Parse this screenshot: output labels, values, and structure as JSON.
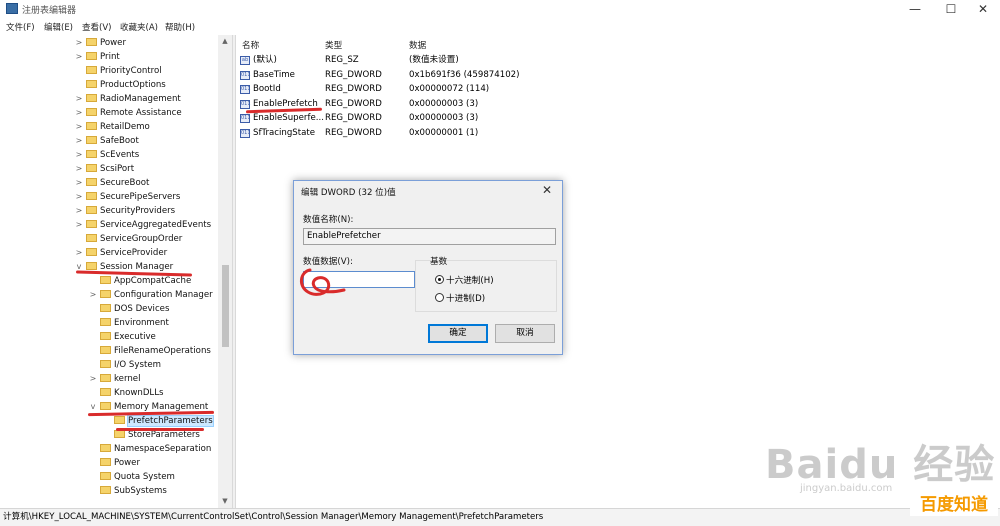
{
  "window": {
    "title": "注册表编辑器",
    "controls": {
      "minimize": "—",
      "maximize": "☐",
      "close": "✕"
    }
  },
  "menu": [
    "文件(F)",
    "编辑(E)",
    "查看(V)",
    "收藏夹(A)",
    "帮助(H)"
  ],
  "tree": [
    {
      "label": "Power",
      "expander": ">",
      "level": 0
    },
    {
      "label": "Print",
      "expander": ">",
      "level": 0
    },
    {
      "label": "PriorityControl",
      "expander": "",
      "level": 0
    },
    {
      "label": "ProductOptions",
      "expander": "",
      "level": 0
    },
    {
      "label": "RadioManagement",
      "expander": ">",
      "level": 0
    },
    {
      "label": "Remote Assistance",
      "expander": ">",
      "level": 0
    },
    {
      "label": "RetailDemo",
      "expander": ">",
      "level": 0
    },
    {
      "label": "SafeBoot",
      "expander": ">",
      "level": 0
    },
    {
      "label": "ScEvents",
      "expander": ">",
      "level": 0
    },
    {
      "label": "ScsiPort",
      "expander": ">",
      "level": 0
    },
    {
      "label": "SecureBoot",
      "expander": ">",
      "level": 0
    },
    {
      "label": "SecurePipeServers",
      "expander": ">",
      "level": 0
    },
    {
      "label": "SecurityProviders",
      "expander": ">",
      "level": 0
    },
    {
      "label": "ServiceAggregatedEvents",
      "expander": ">",
      "level": 0
    },
    {
      "label": "ServiceGroupOrder",
      "expander": "",
      "level": 0
    },
    {
      "label": "ServiceProvider",
      "expander": ">",
      "level": 0
    },
    {
      "label": "Session Manager",
      "expander": "v",
      "level": 0
    },
    {
      "label": "AppCompatCache",
      "expander": "",
      "level": 1
    },
    {
      "label": "Configuration Manager",
      "expander": ">",
      "level": 1
    },
    {
      "label": "DOS Devices",
      "expander": "",
      "level": 1
    },
    {
      "label": "Environment",
      "expander": "",
      "level": 1
    },
    {
      "label": "Executive",
      "expander": "",
      "level": 1
    },
    {
      "label": "FileRenameOperations",
      "expander": "",
      "level": 1
    },
    {
      "label": "I/O System",
      "expander": "",
      "level": 1
    },
    {
      "label": "kernel",
      "expander": ">",
      "level": 1
    },
    {
      "label": "KnownDLLs",
      "expander": "",
      "level": 1
    },
    {
      "label": "Memory Management",
      "expander": "v",
      "level": 1
    },
    {
      "label": "PrefetchParameters",
      "expander": "",
      "level": 2,
      "selected": true
    },
    {
      "label": "StoreParameters",
      "expander": "",
      "level": 2
    },
    {
      "label": "NamespaceSeparation",
      "expander": "",
      "level": 1
    },
    {
      "label": "Power",
      "expander": "",
      "level": 1
    },
    {
      "label": "Quota System",
      "expander": "",
      "level": 1
    },
    {
      "label": "SubSystems",
      "expander": "",
      "level": 1
    }
  ],
  "columns": {
    "name": "名称",
    "type": "类型",
    "data": "数据"
  },
  "values": [
    {
      "name": "(默认)",
      "type": "REG_SZ",
      "data": "(数值未设置)",
      "icon": "ab"
    },
    {
      "name": "BaseTime",
      "type": "REG_DWORD",
      "data": "0x1b691f36 (459874102)",
      "icon": "011"
    },
    {
      "name": "BootId",
      "type": "REG_DWORD",
      "data": "0x00000072 (114)",
      "icon": "011"
    },
    {
      "name": "EnablePrefetch",
      "type": "REG_DWORD",
      "data": "0x00000003 (3)",
      "icon": "011"
    },
    {
      "name": "EnableSuperfe...",
      "type": "REG_DWORD",
      "data": "0x00000003 (3)",
      "icon": "011"
    },
    {
      "name": "SfTracingState",
      "type": "REG_DWORD",
      "data": "0x00000001 (1)",
      "icon": "011"
    }
  ],
  "status": "计算机\\HKEY_LOCAL_MACHINE\\SYSTEM\\CurrentControlSet\\Control\\Session Manager\\Memory Management\\PrefetchParameters",
  "dialog": {
    "title": "编辑 DWORD (32 位)值",
    "name_label": "数值名称(N):",
    "name_value": "EnablePrefetcher",
    "data_label": "数值数据(V):",
    "data_value": "",
    "base_label": "基数",
    "radio_hex": "十六进制(H)",
    "radio_dec": "十进制(D)",
    "selected_base": "hex",
    "ok": "确定",
    "cancel": "取消"
  },
  "watermark": {
    "logo": "Baidu 经验",
    "url": "jingyan.baidu.com",
    "brand": "百度知道"
  },
  "colors": {
    "annotation": "#d92b2b",
    "selection": "#cde8ff",
    "brand": "#f59a00"
  }
}
